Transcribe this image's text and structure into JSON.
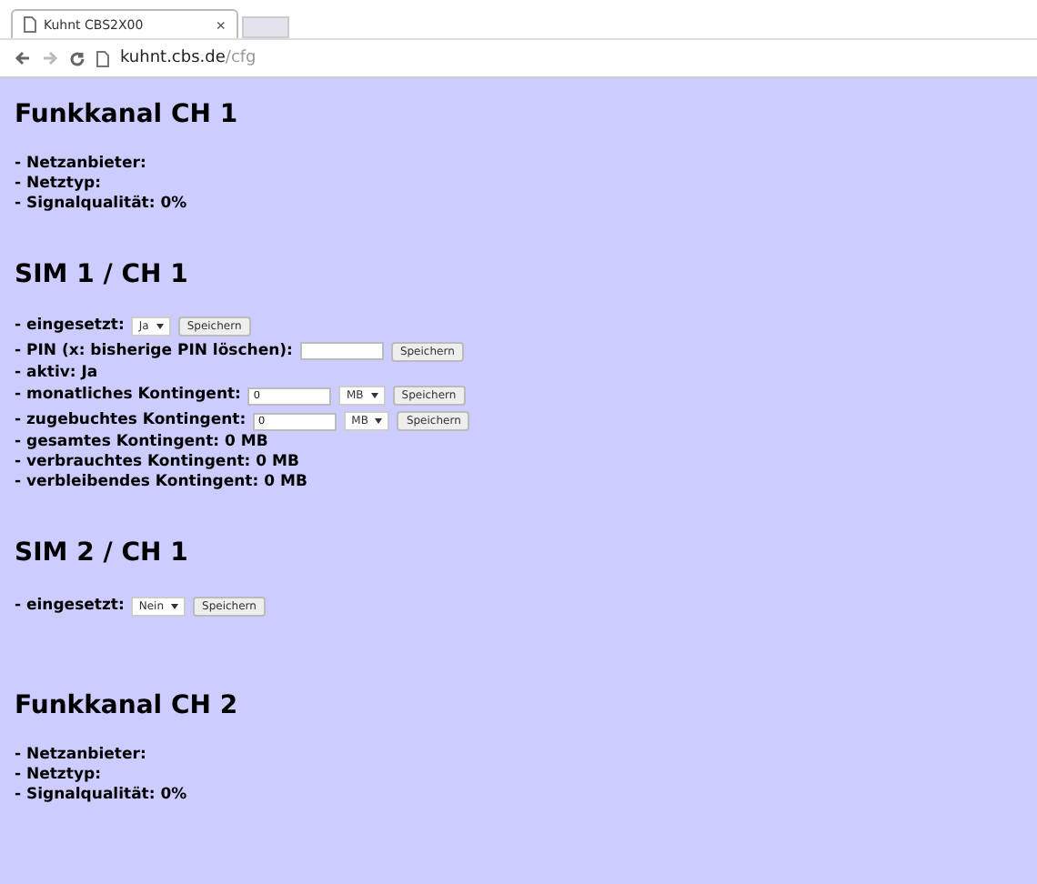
{
  "browser": {
    "tab_title": "Kuhnt CBS2X00",
    "tab_close": "×",
    "url_host": "kuhnt.cbs.de",
    "url_path": "/cfg"
  },
  "sections": [
    {
      "title": "Funkkanal CH 1",
      "items": [
        {
          "label": "- Netzanbieter:"
        },
        {
          "label": "- Netztyp:"
        },
        {
          "label": "- Signalqualität: 0%"
        }
      ]
    },
    {
      "title": "SIM 1 / CH 1",
      "items": [
        {
          "label": "- eingesetzt:",
          "controls": [
            {
              "kind": "select",
              "value": "Ja"
            },
            {
              "kind": "button",
              "label": "Speichern"
            }
          ]
        },
        {
          "label": "- PIN (x: bisherige PIN löschen):",
          "controls": [
            {
              "kind": "input"
            },
            {
              "kind": "button",
              "label": "Speichern"
            }
          ]
        },
        {
          "label": "- aktiv: Ja"
        },
        {
          "label": "- monatliches Kontingent:",
          "controls": [
            {
              "kind": "input",
              "value": "0"
            },
            {
              "kind": "select",
              "value": "MB"
            },
            {
              "kind": "button",
              "label": "Speichern"
            }
          ]
        },
        {
          "label": "- zugebuchtes Kontingent:",
          "controls": [
            {
              "kind": "input",
              "value": "0"
            },
            {
              "kind": "select",
              "value": "MB"
            },
            {
              "kind": "button",
              "label": "Speichern"
            }
          ]
        },
        {
          "label": "- gesamtes Kontingent: 0 MB"
        },
        {
          "label": "- verbrauchtes Kontingent: 0 MB"
        },
        {
          "label": "- verbleibendes Kontingent: 0 MB"
        }
      ]
    },
    {
      "title": "SIM 2 / CH 1",
      "items": [
        {
          "label": "- eingesetzt:",
          "controls": [
            {
              "kind": "select",
              "value": "Nein"
            },
            {
              "kind": "button",
              "label": "Speichern"
            }
          ]
        }
      ]
    },
    {
      "title": "Funkkanal CH 2",
      "items": [
        {
          "label": "- Netzanbieter:"
        },
        {
          "label": "- Netztyp:"
        },
        {
          "label": "- Signalqualität: 0%"
        }
      ]
    }
  ]
}
